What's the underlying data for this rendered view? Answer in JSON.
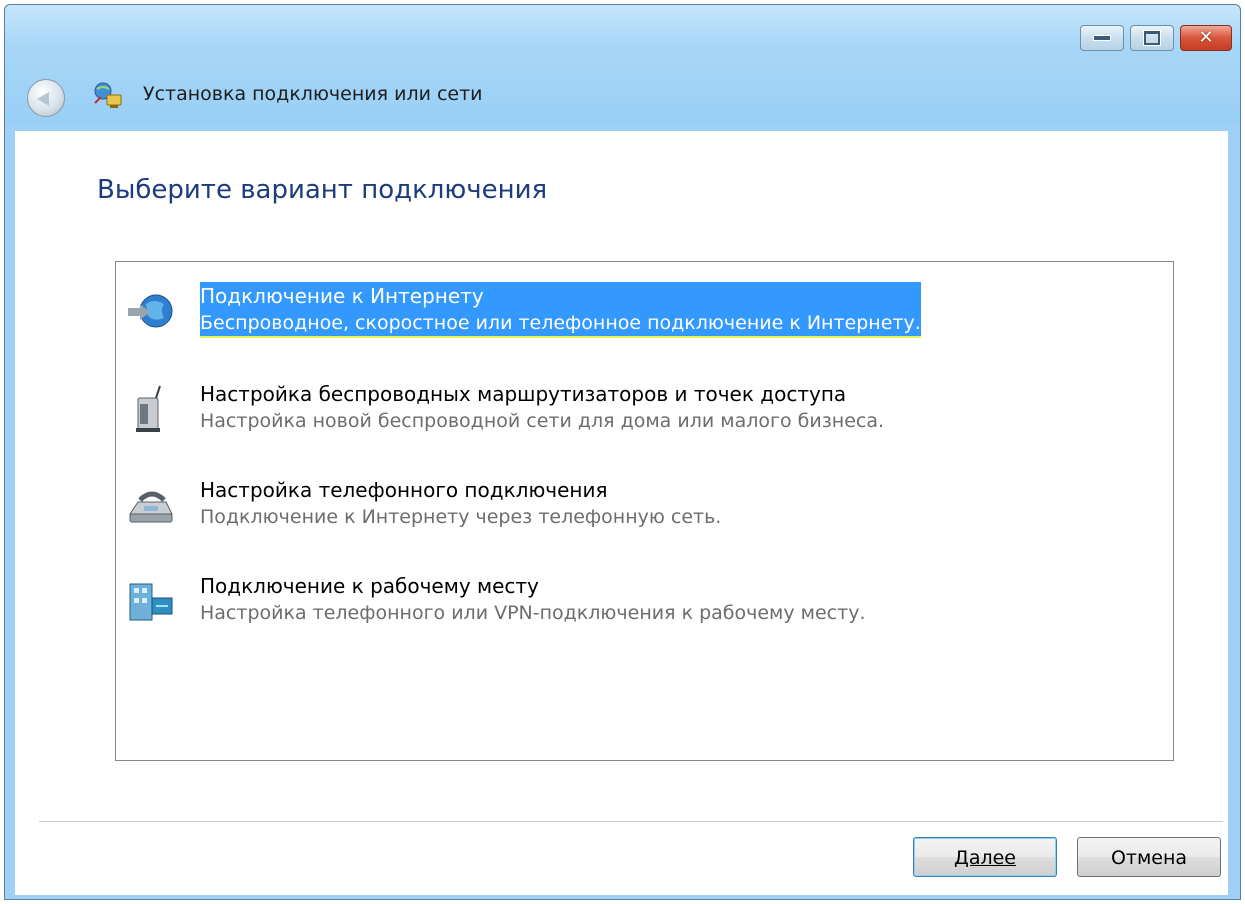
{
  "window": {
    "title": "Установка подключения или сети",
    "controls": {
      "minimize": "minimize-icon",
      "maximize": "maximize-icon",
      "close": "close-icon"
    }
  },
  "page": {
    "heading": "Выберите вариант подключения"
  },
  "options": [
    {
      "title": "Подключение к Интернету",
      "description": "Беспроводное, скоростное или телефонное подключение к Интернету.",
      "icon": "globe-connect-icon",
      "selected": true
    },
    {
      "title": "Настройка беспроводных маршрутизаторов и точек доступа",
      "description": "Настройка новой беспроводной сети для дома или малого бизнеса.",
      "icon": "wireless-router-icon",
      "selected": false
    },
    {
      "title": "Настройка телефонного подключения",
      "description": "Подключение к Интернету через телефонную сеть.",
      "icon": "modem-phone-icon",
      "selected": false
    },
    {
      "title": "Подключение к рабочему месту",
      "description": "Настройка телефонного или VPN-подключения к рабочему месту.",
      "icon": "workplace-icon",
      "selected": false
    }
  ],
  "footer": {
    "next_label": "Далее",
    "cancel_label": "Отмена"
  },
  "colors": {
    "selection": "#3399ff",
    "heading": "#1c3c7c",
    "titlebar": "#9fd0f5"
  }
}
